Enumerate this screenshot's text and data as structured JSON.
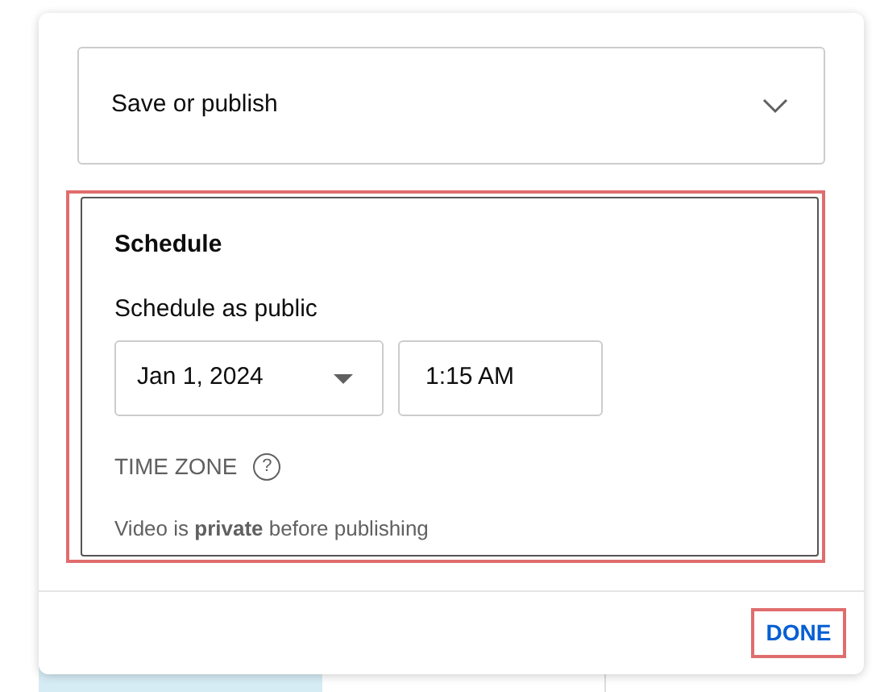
{
  "save_section": {
    "title": "Save or publish",
    "expanded": false
  },
  "schedule": {
    "title": "Schedule",
    "highlighted": true,
    "label": "Schedule as public",
    "date": "Jan 1, 2024",
    "time": "1:15 AM",
    "time_zone_label": "TIME ZONE",
    "help_icon": "?",
    "note": "Video is **private** before publishing"
  },
  "done_button": {
    "label": "DONE",
    "highlighted": true
  }
}
